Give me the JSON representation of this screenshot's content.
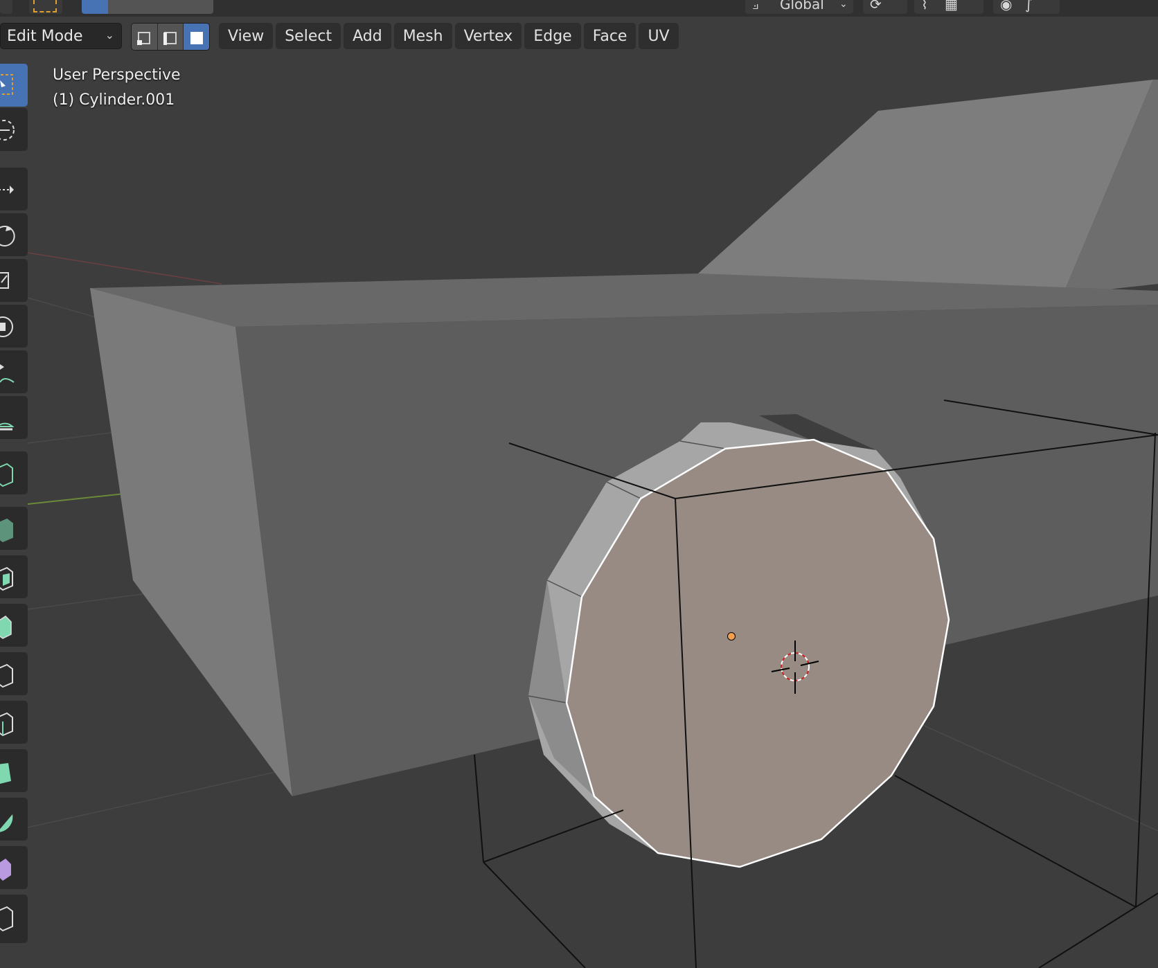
{
  "header": {
    "mode_label": "Edit Mode",
    "menu": [
      "View",
      "Select",
      "Add",
      "Mesh",
      "Vertex",
      "Edge",
      "Face",
      "UV"
    ],
    "select_modes": [
      "vertex-select",
      "edge-select",
      "face-select"
    ],
    "active_select_mode": "face-select",
    "transform_orientation": "Global"
  },
  "viewport": {
    "view_name": "User Perspective",
    "object_label": "(1) Cylinder.001"
  },
  "toolbar": {
    "tools": [
      "select-box-icon",
      "cursor-icon",
      "move-icon",
      "rotate-icon",
      "scale-icon",
      "transform-icon",
      "annotate-icon",
      "measure-icon",
      "add-cube-icon",
      "extrude-region-icon",
      "inset-faces-icon",
      "bevel-icon",
      "loop-cut-icon",
      "knife-icon",
      "poly-build-icon",
      "spin-icon",
      "smooth-icon",
      "edge-slide-icon"
    ],
    "active_tool": "select-box-icon"
  },
  "colors": {
    "viewport_bg": "#3d3d3d",
    "selected_face": "#978b83",
    "active_accent": "#4772b3",
    "origin_dot": "#f0a050"
  }
}
